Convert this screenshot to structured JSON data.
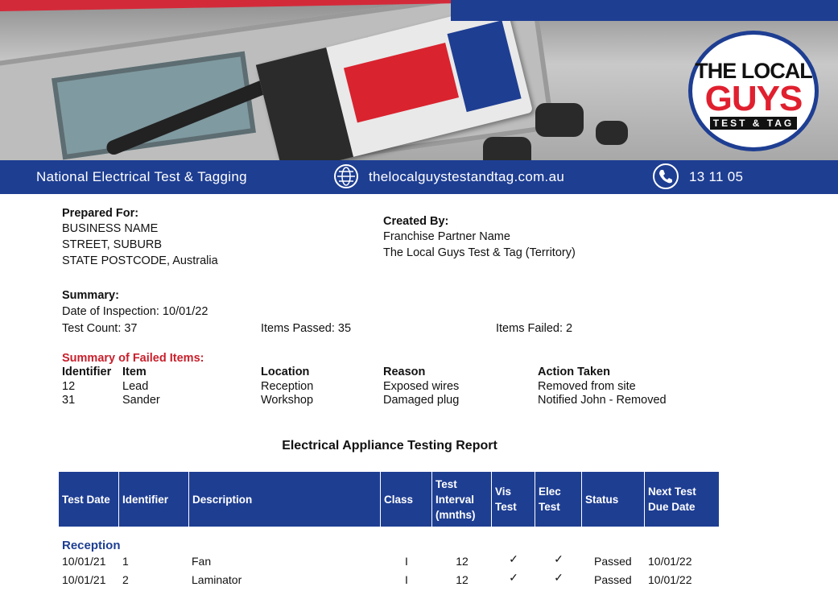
{
  "header": {
    "tagline": "National Electrical Test & Tagging",
    "website": "thelocalguystestandtag.com.au",
    "phone": "13 11 05",
    "logo": {
      "line1": "THE LOCAL",
      "line2": "GUYS",
      "line3": "TEST & TAG"
    },
    "icons": {
      "web": "globe-icon",
      "phone": "phone-icon"
    },
    "colors": {
      "brand_blue": "#1e3e92",
      "brand_red": "#d9232f"
    }
  },
  "prepared_for": {
    "heading": "Prepared For:",
    "lines": [
      "BUSINESS NAME",
      "STREET, SUBURB",
      "STATE POSTCODE, Australia"
    ]
  },
  "created_by": {
    "heading": "Created By:",
    "lines": [
      "Franchise Partner Name",
      "The Local Guys Test & Tag (Territory)"
    ]
  },
  "summary": {
    "heading": "Summary:",
    "date": "Date of Inspection: 10/01/22",
    "test_count": "Test Count: 37",
    "items_passed": "Items Passed: 35",
    "items_failed": "Items Failed: 2"
  },
  "failed_items": {
    "heading": "Summary of Failed Items:",
    "columns": [
      "Identifier",
      "Item",
      "Location",
      "Reason",
      "Action Taken"
    ],
    "rows": [
      {
        "identifier": "12",
        "item": "Lead",
        "location": "Reception",
        "reason": "Exposed wires",
        "action": "Removed from site"
      },
      {
        "identifier": "31",
        "item": "Sander",
        "location": "Workshop",
        "reason": "Damaged plug",
        "action": "Notified John - Removed"
      }
    ]
  },
  "report": {
    "title": "Electrical Appliance Testing Report",
    "columns": [
      "Test Date",
      "Identifier",
      "Description",
      "Class",
      "Test Interval (mnths)",
      "Vis Test",
      "Elec Test",
      "Status",
      "Next Test Due Date"
    ],
    "sections": [
      {
        "name": "Reception",
        "rows": [
          {
            "test_date": "10/01/21",
            "identifier": "1",
            "description": "Fan",
            "class": "I",
            "interval": "12",
            "vis": "✓",
            "elec": "✓",
            "status": "Passed",
            "next_due": "10/01/22"
          },
          {
            "test_date": "10/01/21",
            "identifier": "2",
            "description": "Laminator",
            "class": "I",
            "interval": "12",
            "vis": "✓",
            "elec": "✓",
            "status": "Passed",
            "next_due": "10/01/22"
          }
        ]
      }
    ]
  }
}
